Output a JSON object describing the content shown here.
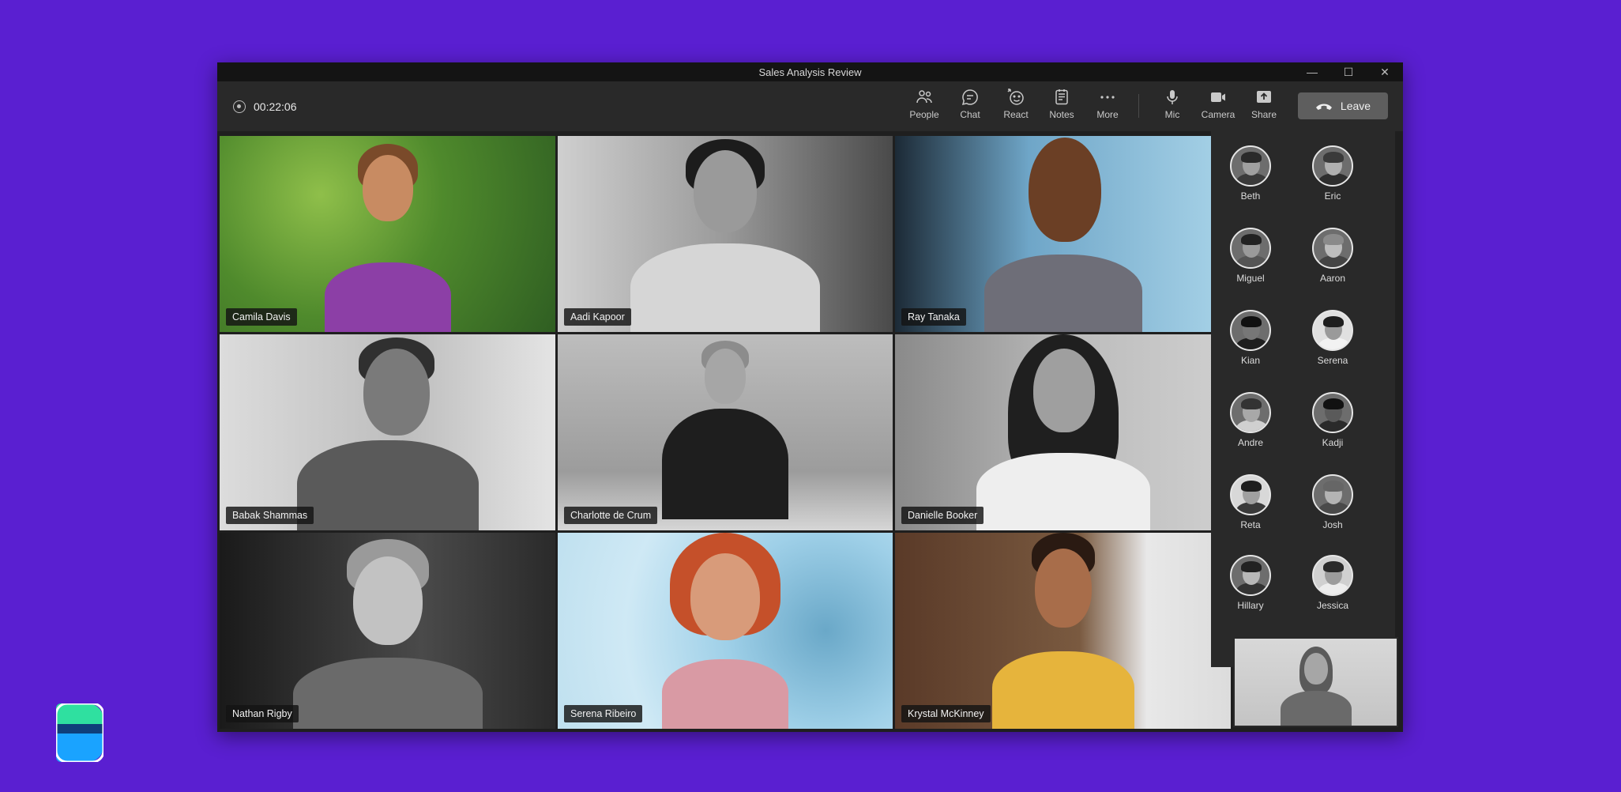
{
  "window": {
    "title": "Sales Analysis Review",
    "controls": {
      "minimize": "—",
      "maximize": "☐",
      "close": "✕"
    }
  },
  "toolbar": {
    "timer": "00:22:06",
    "buttons": [
      {
        "label": "People",
        "icon": "people-icon"
      },
      {
        "label": "Chat",
        "icon": "chat-icon"
      },
      {
        "label": "React",
        "icon": "react-icon"
      },
      {
        "label": "Notes",
        "icon": "notes-icon"
      },
      {
        "label": "More",
        "icon": "more-icon"
      }
    ],
    "media": [
      {
        "label": "Mic",
        "icon": "mic-icon"
      },
      {
        "label": "Camera",
        "icon": "camera-icon"
      },
      {
        "label": "Share",
        "icon": "share-icon"
      }
    ],
    "leave_label": "Leave"
  },
  "tiles": [
    {
      "name": "Camila Davis"
    },
    {
      "name": "Aadi Kapoor"
    },
    {
      "name": "Ray Tanaka"
    },
    {
      "name": "Babak Shammas"
    },
    {
      "name": "Charlotte de Crum"
    },
    {
      "name": "Danielle Booker"
    },
    {
      "name": "Nathan Rigby"
    },
    {
      "name": "Serena Ribeiro"
    },
    {
      "name": "Krystal McKinney"
    }
  ],
  "participants": [
    {
      "name": "Beth"
    },
    {
      "name": "Eric"
    },
    {
      "name": "Miguel"
    },
    {
      "name": "Aaron"
    },
    {
      "name": "Kian"
    },
    {
      "name": "Serena"
    },
    {
      "name": "Andre"
    },
    {
      "name": "Kadji"
    },
    {
      "name": "Reta"
    },
    {
      "name": "Josh"
    },
    {
      "name": "Hillary"
    },
    {
      "name": "Jessica"
    }
  ],
  "colors": {
    "background": "#5a1fd1",
    "window": "#1f1f1f",
    "toolbar": "#292929",
    "leave_button": "#5e5e5e",
    "logo_green": "#2fe0a0",
    "logo_blue": "#1aa3ff"
  }
}
